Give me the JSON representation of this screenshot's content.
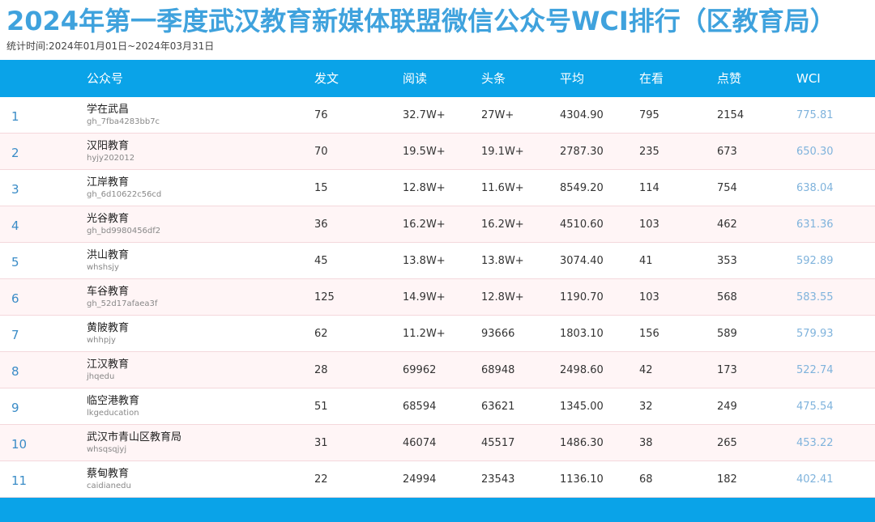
{
  "header": {
    "title": "2024年第一季度武汉教育新媒体联盟微信公众号WCI排行（区教育局）",
    "subtitle": "统计时间:2024年01月01日~2024年03月31日"
  },
  "table": {
    "columns": {
      "account": "公众号",
      "posts": "发文",
      "reads": "阅读",
      "headline": "头条",
      "average": "平均",
      "watching": "在看",
      "likes": "点赞",
      "wci": "WCI"
    },
    "rows": [
      {
        "rank": "1",
        "name": "学在武昌",
        "account": "gh_7fba4283bb7c",
        "posts": "76",
        "reads": "32.7W+",
        "headline": "27W+",
        "average": "4304.90",
        "watching": "795",
        "likes": "2154",
        "wci": "775.81"
      },
      {
        "rank": "2",
        "name": "汉阳教育",
        "account": "hyjy202012",
        "posts": "70",
        "reads": "19.5W+",
        "headline": "19.1W+",
        "average": "2787.30",
        "watching": "235",
        "likes": "673",
        "wci": "650.30"
      },
      {
        "rank": "3",
        "name": "江岸教育",
        "account": "gh_6d10622c56cd",
        "posts": "15",
        "reads": "12.8W+",
        "headline": "11.6W+",
        "average": "8549.20",
        "watching": "114",
        "likes": "754",
        "wci": "638.04"
      },
      {
        "rank": "4",
        "name": "光谷教育",
        "account": "gh_bd9980456df2",
        "posts": "36",
        "reads": "16.2W+",
        "headline": "16.2W+",
        "average": "4510.60",
        "watching": "103",
        "likes": "462",
        "wci": "631.36"
      },
      {
        "rank": "5",
        "name": "洪山教育",
        "account": "whshsjy",
        "posts": "45",
        "reads": "13.8W+",
        "headline": "13.8W+",
        "average": "3074.40",
        "watching": "41",
        "likes": "353",
        "wci": "592.89"
      },
      {
        "rank": "6",
        "name": "车谷教育",
        "account": "gh_52d17afaea3f",
        "posts": "125",
        "reads": "14.9W+",
        "headline": "12.8W+",
        "average": "1190.70",
        "watching": "103",
        "likes": "568",
        "wci": "583.55"
      },
      {
        "rank": "7",
        "name": "黄陂教育",
        "account": "whhpjy",
        "posts": "62",
        "reads": "11.2W+",
        "headline": "93666",
        "average": "1803.10",
        "watching": "156",
        "likes": "589",
        "wci": "579.93"
      },
      {
        "rank": "8",
        "name": "江汉教育",
        "account": "jhqedu",
        "posts": "28",
        "reads": "69962",
        "headline": "68948",
        "average": "2498.60",
        "watching": "42",
        "likes": "173",
        "wci": "522.74"
      },
      {
        "rank": "9",
        "name": "临空港教育",
        "account": "lkgeducation",
        "posts": "51",
        "reads": "68594",
        "headline": "63621",
        "average": "1345.00",
        "watching": "32",
        "likes": "249",
        "wci": "475.54"
      },
      {
        "rank": "10",
        "name": "武汉市青山区教育局",
        "account": "whsqsqjyj",
        "posts": "31",
        "reads": "46074",
        "headline": "45517",
        "average": "1486.30",
        "watching": "38",
        "likes": "265",
        "wci": "453.22"
      },
      {
        "rank": "11",
        "name": "蔡甸教育",
        "account": "caidianedu",
        "posts": "22",
        "reads": "24994",
        "headline": "23543",
        "average": "1136.10",
        "watching": "68",
        "likes": "182",
        "wci": "402.41"
      }
    ]
  },
  "colors": {
    "title": "#3fa2dd",
    "header_bar": "#0aa3e8",
    "row_alt": "#fff5f6",
    "wci_text": "#7fb3dc"
  }
}
